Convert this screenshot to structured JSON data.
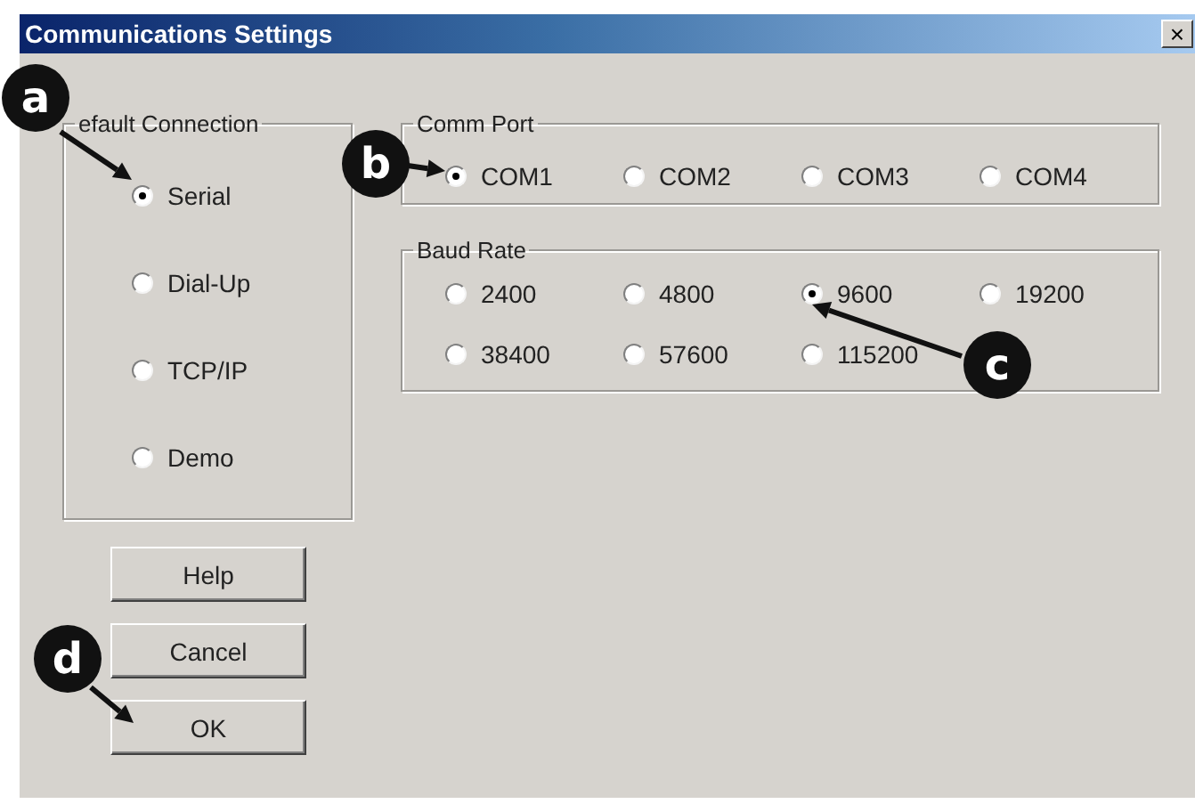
{
  "window": {
    "title": "Communications Settings",
    "close": "×"
  },
  "connection": {
    "legend": "efault Connection",
    "options": [
      {
        "label": "Serial",
        "selected": true
      },
      {
        "label": "Dial-Up",
        "selected": false
      },
      {
        "label": "TCP/IP",
        "selected": false
      },
      {
        "label": "Demo",
        "selected": false
      }
    ]
  },
  "comm_port": {
    "legend": "Comm Port",
    "options": [
      {
        "label": "COM1",
        "selected": true
      },
      {
        "label": "COM2",
        "selected": false
      },
      {
        "label": "COM3",
        "selected": false
      },
      {
        "label": "COM4",
        "selected": false
      }
    ]
  },
  "baud_rate": {
    "legend": "Baud Rate",
    "options": [
      {
        "label": "2400",
        "selected": false
      },
      {
        "label": "4800",
        "selected": false
      },
      {
        "label": "9600",
        "selected": true
      },
      {
        "label": "19200",
        "selected": false
      },
      {
        "label": "38400",
        "selected": false
      },
      {
        "label": "57600",
        "selected": false
      },
      {
        "label": "115200",
        "selected": false
      }
    ]
  },
  "buttons": [
    "Help",
    "Cancel",
    "OK"
  ],
  "callouts": [
    {
      "label": "a"
    },
    {
      "label": "b"
    },
    {
      "label": "c"
    },
    {
      "label": "d"
    }
  ]
}
